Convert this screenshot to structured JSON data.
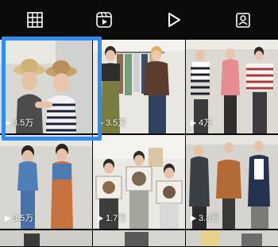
{
  "tabs": [
    {
      "icon": "grid-icon",
      "active": false
    },
    {
      "icon": "reels-icon",
      "active": false
    },
    {
      "icon": "play-icon",
      "active": true
    },
    {
      "icon": "tagged-person-icon",
      "active": false
    }
  ],
  "videos": [
    {
      "views": "3.5万",
      "selected": true
    },
    {
      "views": "3.5万",
      "selected": false
    },
    {
      "views": "4万",
      "selected": false
    },
    {
      "views": "3.5万",
      "selected": false
    },
    {
      "views": "1.7万",
      "selected": false
    },
    {
      "views": "3.8万",
      "selected": false
    }
  ],
  "colors": {
    "background": "#0b0b0b",
    "selection": "#2f8cf5",
    "icon": "#ffffff"
  }
}
